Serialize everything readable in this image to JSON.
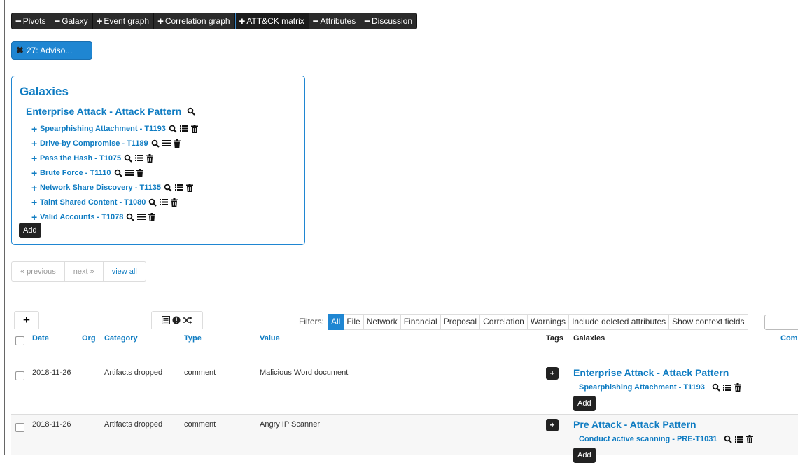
{
  "toolbar": {
    "items": [
      {
        "sym": "−",
        "label": "Pivots"
      },
      {
        "sym": "−",
        "label": "Galaxy"
      },
      {
        "sym": "+",
        "label": "Event graph"
      },
      {
        "sym": "+",
        "label": "Correlation graph"
      },
      {
        "sym": "+",
        "label": "ATT&CK matrix"
      },
      {
        "sym": "−",
        "label": "Attributes"
      },
      {
        "sym": "−",
        "label": "Discussion"
      }
    ]
  },
  "event_pill": {
    "close": "✖",
    "label": "27: Adviso..."
  },
  "galaxies": {
    "title": "Galaxies",
    "cluster": "Enterprise Attack - Attack Pattern",
    "items": [
      "Spearphishing Attachment - T1193",
      "Drive-by Compromise - T1189",
      "Pass the Hash - T1075",
      "Brute Force - T1110",
      "Network Share Discovery - T1135",
      "Taint Shared Content - T1080",
      "Valid Accounts - T1078"
    ],
    "add_label": "Add"
  },
  "pagination": {
    "previous": "« previous",
    "next": "next »",
    "view_all": "view all"
  },
  "tabs": {
    "add": "+"
  },
  "filters": {
    "label": "Filters:",
    "items": [
      "All",
      "File",
      "Network",
      "Financial",
      "Proposal",
      "Correlation",
      "Warnings",
      "Include deleted attributes",
      "Show context fields"
    ]
  },
  "table": {
    "headers": {
      "date": "Date",
      "org": "Org",
      "category": "Category",
      "type": "Type",
      "value": "Value",
      "tags": "Tags",
      "galaxies": "Galaxies",
      "comment": "Com"
    },
    "rows": [
      {
        "date": "2018-11-26",
        "category": "Artifacts dropped",
        "type": "comment",
        "value": "Malicious Word document",
        "tag_add": "+",
        "cluster": "Enterprise Attack - Attack Pattern",
        "galaxy": "Spearphishing Attachment - T1193",
        "add_label": "Add"
      },
      {
        "date": "2018-11-26",
        "category": "Artifacts dropped",
        "type": "comment",
        "value": "Angry IP Scanner",
        "tag_add": "+",
        "cluster": "Pre Attack - Attack Pattern",
        "galaxy": "Conduct active scanning - PRE-T1031",
        "add_label": "Add"
      }
    ]
  }
}
